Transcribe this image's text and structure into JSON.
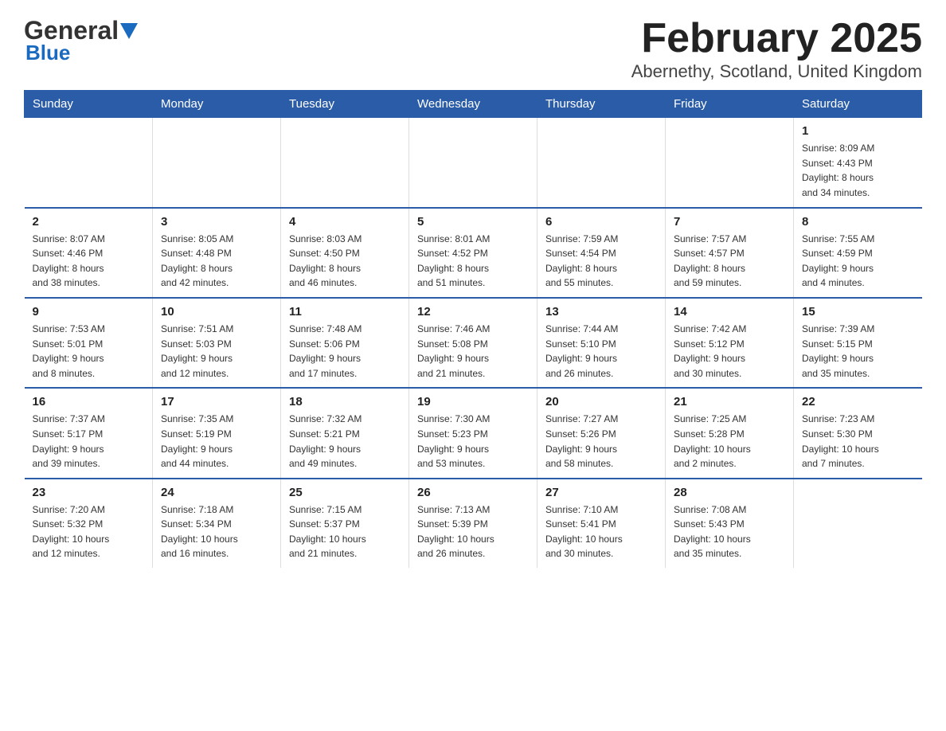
{
  "header": {
    "logo_general": "General",
    "logo_blue": "Blue",
    "title": "February 2025",
    "subtitle": "Abernethy, Scotland, United Kingdom"
  },
  "weekdays": [
    "Sunday",
    "Monday",
    "Tuesday",
    "Wednesday",
    "Thursday",
    "Friday",
    "Saturday"
  ],
  "weeks": [
    {
      "days": [
        {
          "num": "",
          "info": "",
          "empty": true
        },
        {
          "num": "",
          "info": "",
          "empty": true
        },
        {
          "num": "",
          "info": "",
          "empty": true
        },
        {
          "num": "",
          "info": "",
          "empty": true
        },
        {
          "num": "",
          "info": "",
          "empty": true
        },
        {
          "num": "",
          "info": "",
          "empty": true
        },
        {
          "num": "1",
          "info": "Sunrise: 8:09 AM\nSunset: 4:43 PM\nDaylight: 8 hours\nand 34 minutes.",
          "empty": false
        }
      ]
    },
    {
      "days": [
        {
          "num": "2",
          "info": "Sunrise: 8:07 AM\nSunset: 4:46 PM\nDaylight: 8 hours\nand 38 minutes.",
          "empty": false
        },
        {
          "num": "3",
          "info": "Sunrise: 8:05 AM\nSunset: 4:48 PM\nDaylight: 8 hours\nand 42 minutes.",
          "empty": false
        },
        {
          "num": "4",
          "info": "Sunrise: 8:03 AM\nSunset: 4:50 PM\nDaylight: 8 hours\nand 46 minutes.",
          "empty": false
        },
        {
          "num": "5",
          "info": "Sunrise: 8:01 AM\nSunset: 4:52 PM\nDaylight: 8 hours\nand 51 minutes.",
          "empty": false
        },
        {
          "num": "6",
          "info": "Sunrise: 7:59 AM\nSunset: 4:54 PM\nDaylight: 8 hours\nand 55 minutes.",
          "empty": false
        },
        {
          "num": "7",
          "info": "Sunrise: 7:57 AM\nSunset: 4:57 PM\nDaylight: 8 hours\nand 59 minutes.",
          "empty": false
        },
        {
          "num": "8",
          "info": "Sunrise: 7:55 AM\nSunset: 4:59 PM\nDaylight: 9 hours\nand 4 minutes.",
          "empty": false
        }
      ]
    },
    {
      "days": [
        {
          "num": "9",
          "info": "Sunrise: 7:53 AM\nSunset: 5:01 PM\nDaylight: 9 hours\nand 8 minutes.",
          "empty": false
        },
        {
          "num": "10",
          "info": "Sunrise: 7:51 AM\nSunset: 5:03 PM\nDaylight: 9 hours\nand 12 minutes.",
          "empty": false
        },
        {
          "num": "11",
          "info": "Sunrise: 7:48 AM\nSunset: 5:06 PM\nDaylight: 9 hours\nand 17 minutes.",
          "empty": false
        },
        {
          "num": "12",
          "info": "Sunrise: 7:46 AM\nSunset: 5:08 PM\nDaylight: 9 hours\nand 21 minutes.",
          "empty": false
        },
        {
          "num": "13",
          "info": "Sunrise: 7:44 AM\nSunset: 5:10 PM\nDaylight: 9 hours\nand 26 minutes.",
          "empty": false
        },
        {
          "num": "14",
          "info": "Sunrise: 7:42 AM\nSunset: 5:12 PM\nDaylight: 9 hours\nand 30 minutes.",
          "empty": false
        },
        {
          "num": "15",
          "info": "Sunrise: 7:39 AM\nSunset: 5:15 PM\nDaylight: 9 hours\nand 35 minutes.",
          "empty": false
        }
      ]
    },
    {
      "days": [
        {
          "num": "16",
          "info": "Sunrise: 7:37 AM\nSunset: 5:17 PM\nDaylight: 9 hours\nand 39 minutes.",
          "empty": false
        },
        {
          "num": "17",
          "info": "Sunrise: 7:35 AM\nSunset: 5:19 PM\nDaylight: 9 hours\nand 44 minutes.",
          "empty": false
        },
        {
          "num": "18",
          "info": "Sunrise: 7:32 AM\nSunset: 5:21 PM\nDaylight: 9 hours\nand 49 minutes.",
          "empty": false
        },
        {
          "num": "19",
          "info": "Sunrise: 7:30 AM\nSunset: 5:23 PM\nDaylight: 9 hours\nand 53 minutes.",
          "empty": false
        },
        {
          "num": "20",
          "info": "Sunrise: 7:27 AM\nSunset: 5:26 PM\nDaylight: 9 hours\nand 58 minutes.",
          "empty": false
        },
        {
          "num": "21",
          "info": "Sunrise: 7:25 AM\nSunset: 5:28 PM\nDaylight: 10 hours\nand 2 minutes.",
          "empty": false
        },
        {
          "num": "22",
          "info": "Sunrise: 7:23 AM\nSunset: 5:30 PM\nDaylight: 10 hours\nand 7 minutes.",
          "empty": false
        }
      ]
    },
    {
      "days": [
        {
          "num": "23",
          "info": "Sunrise: 7:20 AM\nSunset: 5:32 PM\nDaylight: 10 hours\nand 12 minutes.",
          "empty": false
        },
        {
          "num": "24",
          "info": "Sunrise: 7:18 AM\nSunset: 5:34 PM\nDaylight: 10 hours\nand 16 minutes.",
          "empty": false
        },
        {
          "num": "25",
          "info": "Sunrise: 7:15 AM\nSunset: 5:37 PM\nDaylight: 10 hours\nand 21 minutes.",
          "empty": false
        },
        {
          "num": "26",
          "info": "Sunrise: 7:13 AM\nSunset: 5:39 PM\nDaylight: 10 hours\nand 26 minutes.",
          "empty": false
        },
        {
          "num": "27",
          "info": "Sunrise: 7:10 AM\nSunset: 5:41 PM\nDaylight: 10 hours\nand 30 minutes.",
          "empty": false
        },
        {
          "num": "28",
          "info": "Sunrise: 7:08 AM\nSunset: 5:43 PM\nDaylight: 10 hours\nand 35 minutes.",
          "empty": false
        },
        {
          "num": "",
          "info": "",
          "empty": true
        }
      ]
    }
  ]
}
